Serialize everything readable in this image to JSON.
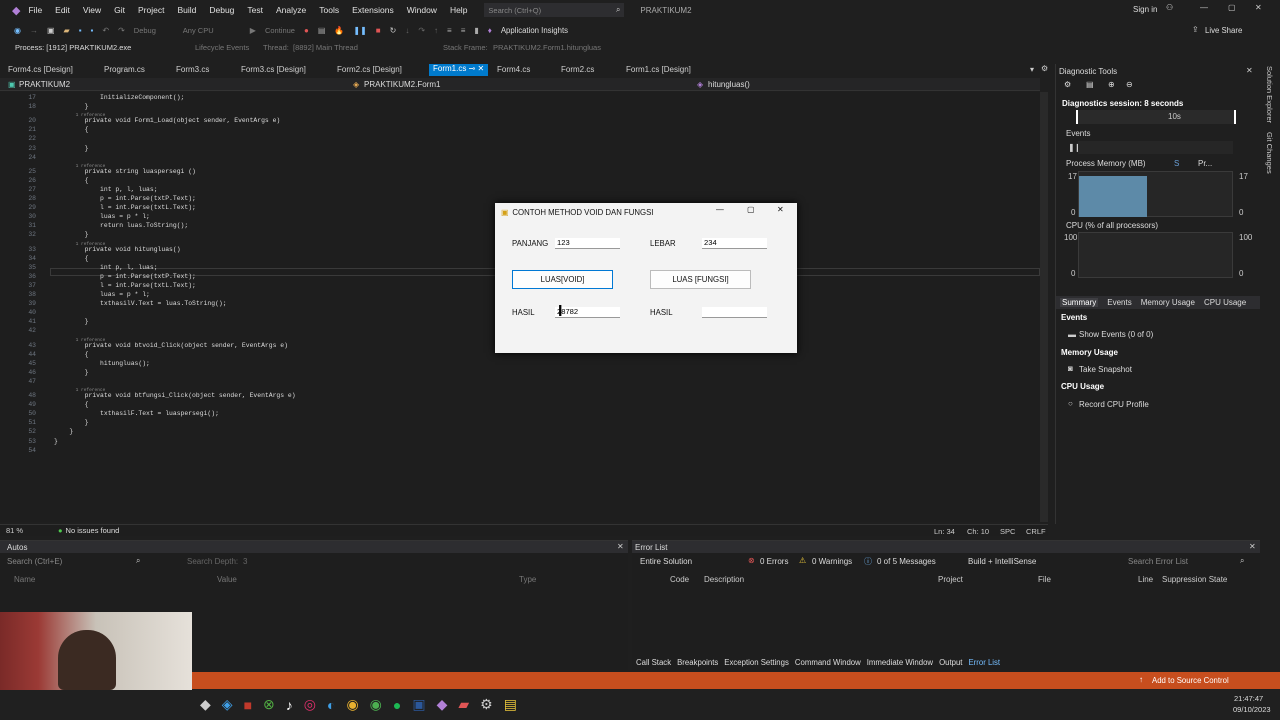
{
  "menu": [
    "File",
    "Edit",
    "View",
    "Git",
    "Project",
    "Build",
    "Debug",
    "Test",
    "Analyze",
    "Tools",
    "Extensions",
    "Window",
    "Help"
  ],
  "search_placeholder": "Search (Ctrl+Q)",
  "app_title": "PRAKTIKUM2",
  "sign_in": "Sign in",
  "toolbar": {
    "config": "Debug",
    "platform": "Any CPU",
    "continue": "Continue",
    "insights": "Application Insights",
    "live_share": "Live Share"
  },
  "toolbar2": {
    "process": "Process: [1912] PRAKTIKUM2.exe",
    "lifecycle": "Lifecycle Events",
    "thread_label": "Thread:",
    "thread": "[8892] Main Thread",
    "stack_label": "Stack Frame:",
    "stack": "PRAKTIKUM2.Form1.hitungluas"
  },
  "tabs": [
    "Form4.cs [Design]",
    "Program.cs",
    "Form3.cs",
    "Form3.cs [Design]",
    "Form2.cs [Design]",
    "Form1.cs",
    "Form4.cs",
    "Form2.cs",
    "Form1.cs [Design]"
  ],
  "nav": {
    "project": "PRAKTIKUM2",
    "class": "PRAKTIKUM2.Form1",
    "member": "hitungluas()"
  },
  "code_lines": [
    {
      "n": "17",
      "t": "            InitializeComponent();"
    },
    {
      "n": "18",
      "t": "        }"
    },
    {
      "n": "",
      "t": "        1 reference",
      "ref": true
    },
    {
      "n": "20",
      "t": "        private void Form1_Load(object sender, EventArgs e)"
    },
    {
      "n": "21",
      "t": "        {"
    },
    {
      "n": "22",
      "t": ""
    },
    {
      "n": "23",
      "t": "        }"
    },
    {
      "n": "24",
      "t": ""
    },
    {
      "n": "",
      "t": "        1 reference",
      "ref": true
    },
    {
      "n": "25",
      "t": "        private string luaspersegi ()"
    },
    {
      "n": "26",
      "t": "        {"
    },
    {
      "n": "27",
      "t": "            int p, l, luas;"
    },
    {
      "n": "28",
      "t": "            p = int.Parse(txtP.Text);"
    },
    {
      "n": "29",
      "t": "            l = int.Parse(txtL.Text);"
    },
    {
      "n": "30",
      "t": "            luas = p * l;"
    },
    {
      "n": "31",
      "t": "            return luas.ToString();"
    },
    {
      "n": "32",
      "t": "        }"
    },
    {
      "n": "",
      "t": "        1 reference",
      "ref": true
    },
    {
      "n": "33",
      "t": "        private void hitungluas()"
    },
    {
      "n": "34",
      "t": "        {"
    },
    {
      "n": "35",
      "t": "            int p, l, luas;"
    },
    {
      "n": "36",
      "t": "            p = int.Parse(txtP.Text);"
    },
    {
      "n": "37",
      "t": "            l = int.Parse(txtL.Text);"
    },
    {
      "n": "38",
      "t": "            luas = p * l;"
    },
    {
      "n": "39",
      "t": "            txthasilV.Text = luas.ToString();"
    },
    {
      "n": "40",
      "t": ""
    },
    {
      "n": "41",
      "t": "        }"
    },
    {
      "n": "42",
      "t": ""
    },
    {
      "n": "",
      "t": "        1 reference",
      "ref": true
    },
    {
      "n": "43",
      "t": "        private void btvoid_Click(object sender, EventArgs e)"
    },
    {
      "n": "44",
      "t": "        {"
    },
    {
      "n": "45",
      "t": "            hitungluas();"
    },
    {
      "n": "46",
      "t": "        }"
    },
    {
      "n": "47",
      "t": ""
    },
    {
      "n": "",
      "t": "        1 reference",
      "ref": true
    },
    {
      "n": "48",
      "t": "        private void btfungsi_Click(object sender, EventArgs e)"
    },
    {
      "n": "49",
      "t": "        {"
    },
    {
      "n": "50",
      "t": "            txthasilF.Text = luaspersegi();"
    },
    {
      "n": "51",
      "t": "        }"
    },
    {
      "n": "52",
      "t": "    }"
    },
    {
      "n": "53",
      "t": "}"
    },
    {
      "n": "54",
      "t": ""
    }
  ],
  "editor_status": {
    "zoom": "81 %",
    "issues": "No issues found",
    "ln": "Ln: 34",
    "ch": "Ch: 10",
    "spc": "SPC",
    "crlf": "CRLF"
  },
  "dialog": {
    "title": "CONTOH METHOD VOID DAN FUNGSI",
    "panjang_label": "PANJANG",
    "panjang_value": "123",
    "lebar_label": "LEBAR",
    "lebar_value": "234",
    "btn_void": "LUAS[VOID]",
    "btn_fungsi": "LUAS [FUNGSI]",
    "hasil1_label": "HASIL",
    "hasil1_value": "28782",
    "hasil2_label": "HASIL",
    "hasil2_value": ""
  },
  "diag": {
    "title": "Diagnostic Tools",
    "session": "Diagnostics session: 8 seconds",
    "tick": "10s",
    "events": "Events",
    "memory": "Process Memory (MB)",
    "mem_legend1": "S",
    "mem_legend2": "Pr...",
    "mem_max": "17",
    "mem_min": "0",
    "cpu": "CPU (% of all processors)",
    "cpu_max": "100",
    "cpu_min": "0",
    "tabs": [
      "Summary",
      "Events",
      "Memory Usage",
      "CPU Usage"
    ],
    "sec_events": "Events",
    "show_events": "Show Events (0 of 0)",
    "sec_memory": "Memory Usage",
    "snapshot": "Take Snapshot",
    "sec_cpu": "CPU Usage",
    "record": "Record CPU Profile"
  },
  "side_tabs": [
    "Solution Explorer",
    "Git Changes"
  ],
  "autos": {
    "title": "Autos",
    "search": "Search (Ctrl+E)",
    "depth": "Search Depth:",
    "depth_val": "3",
    "cols": [
      "Name",
      "Value",
      "Type"
    ]
  },
  "errorlist": {
    "title": "Error List",
    "scope": "Entire Solution",
    "errors": "0 Errors",
    "warnings": "0 Warnings",
    "messages": "0 of 5 Messages",
    "build": "Build + IntelliSense",
    "search": "Search Error List",
    "cols": [
      "Code",
      "Description",
      "Project",
      "File",
      "Line",
      "Suppression State"
    ]
  },
  "bottom_tabs": [
    "Call Stack",
    "Breakpoints",
    "Exception Settings",
    "Command Window",
    "Immediate Window",
    "Output",
    "Error List"
  ],
  "statusbar": {
    "source_control": "Add to Source Control"
  },
  "clock": {
    "time": "21:47:47",
    "date": "09/10/2023"
  },
  "colors": {
    "accent": "#007acc",
    "status": "#c74e1e"
  }
}
